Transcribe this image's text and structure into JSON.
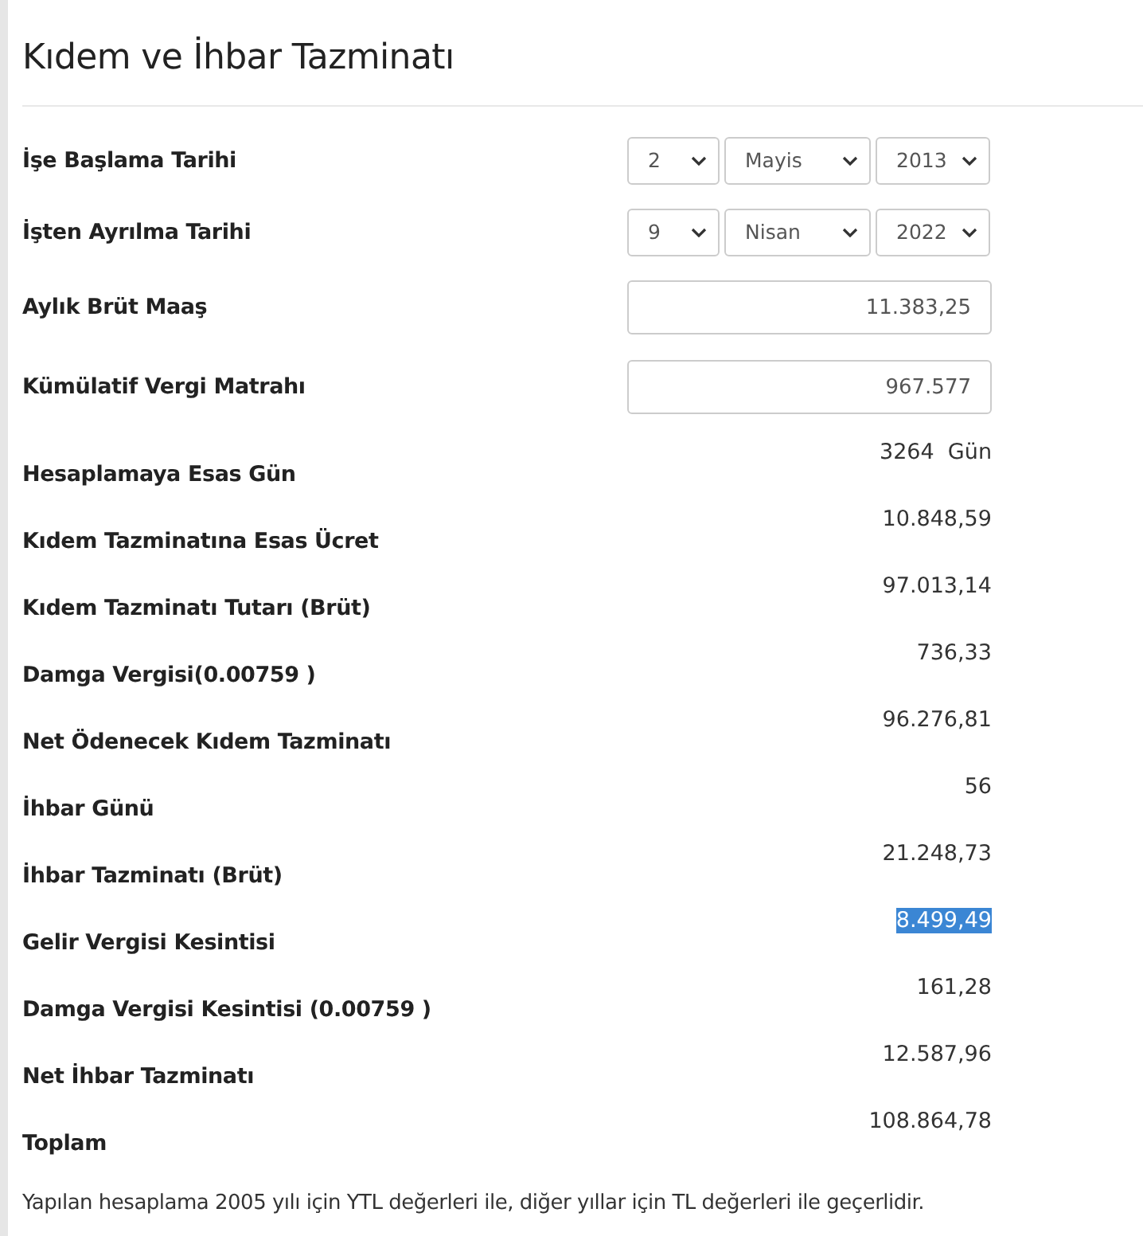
{
  "title": "Kıdem ve İhbar Tazminatı",
  "inputs": [
    {
      "label": "İşe Başlama Tarihi",
      "kind": "date",
      "day": "2",
      "month": "Mayis",
      "year": "2013"
    },
    {
      "label": "İşten Ayrılma Tarihi",
      "kind": "date",
      "day": "9",
      "month": "Nisan",
      "year": "2022"
    },
    {
      "label": "Aylık Brüt Maaş",
      "kind": "text",
      "value": "11.383,25"
    },
    {
      "label": "Kümülatif Vergi Matrahı",
      "kind": "text",
      "value": "967.577"
    }
  ],
  "results": [
    {
      "label": "Hesaplamaya Esas Gün",
      "value": "3264  Gün",
      "highlighted": false
    },
    {
      "label": "Kıdem Tazminatına Esas Ücret",
      "value": "10.848,59",
      "highlighted": false
    },
    {
      "label": "Kıdem Tazminatı Tutarı (Brüt)",
      "value": "97.013,14",
      "highlighted": false
    },
    {
      "label": "Damga Vergisi(0.00759 )",
      "value": "736,33",
      "highlighted": false
    },
    {
      "label": "Net Ödenecek Kıdem Tazminatı",
      "value": "96.276,81",
      "highlighted": false
    },
    {
      "label": "İhbar Günü",
      "value": "56",
      "highlighted": false
    },
    {
      "label": "İhbar Tazminatı (Brüt)",
      "value": "21.248,73",
      "highlighted": false
    },
    {
      "label": "Gelir Vergisi Kesintisi",
      "value": "8.499,49",
      "highlighted": true
    },
    {
      "label": "Damga Vergisi Kesintisi (0.00759 )",
      "value": "161,28",
      "highlighted": false
    },
    {
      "label": "Net İhbar Tazminatı",
      "value": "12.587,96",
      "highlighted": false
    },
    {
      "label": "Toplam",
      "value": "108.864,78",
      "highlighted": false
    }
  ],
  "note": "Yapılan hesaplama 2005 yılı için YTL değerleri ile, diğer yıllar için TL değerleri ile geçerlidir."
}
